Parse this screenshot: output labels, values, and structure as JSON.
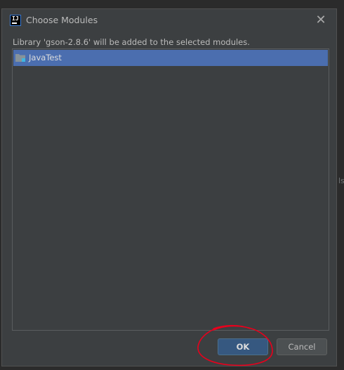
{
  "dialog": {
    "title": "Choose Modules",
    "app_icon": "intellij-idea-icon",
    "close_icon": "close-icon",
    "close_glyph": "✕",
    "message": "Library 'gson-2.8.6' will be added to the selected modules.",
    "app_icon_text": "IJ"
  },
  "modules": {
    "items": [
      {
        "label": "JavaTest",
        "icon": "module-folder-icon",
        "selected": true
      }
    ]
  },
  "buttons": {
    "ok_label": "OK",
    "cancel_label": "Cancel"
  },
  "background": {
    "partial_text": "ls"
  },
  "colors": {
    "dialog_bg": "#3c3f41",
    "selection": "#4b6eaf",
    "ok_button": "#365880",
    "annotation": "#e8001c"
  }
}
